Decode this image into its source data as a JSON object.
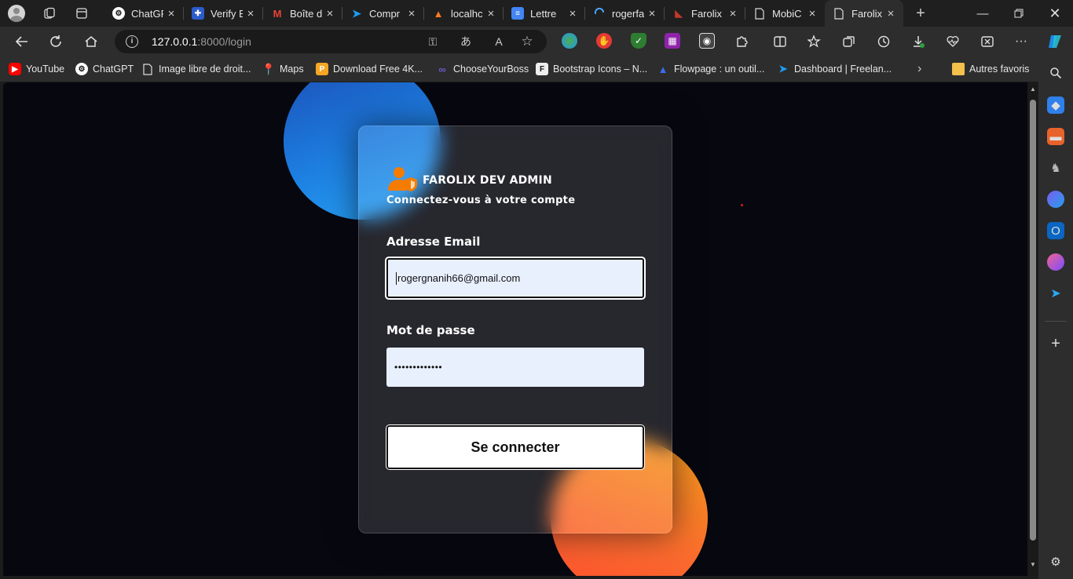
{
  "tabs": [
    {
      "title": "ChatGPT",
      "icon": "chatgpt-icon",
      "color": "#ffffff"
    },
    {
      "title": "Verify E",
      "icon": "puzzle-icon",
      "color": "#3b82f6"
    },
    {
      "title": "Boîte d",
      "icon": "gmail-icon",
      "color": "#ea4335"
    },
    {
      "title": "Compr",
      "icon": "bird-icon",
      "color": "#1d9bf0"
    },
    {
      "title": "localhc",
      "icon": "xampp-icon",
      "color": "#fb7a24"
    },
    {
      "title": "Lettre",
      "icon": "document-icon",
      "color": "#4285f4"
    },
    {
      "title": "rogerfa",
      "icon": "loading-icon",
      "color": "#4aa3ff"
    },
    {
      "title": "Farolix",
      "icon": "farolix-icon",
      "color": "#c0392b"
    },
    {
      "title": "MobiC",
      "icon": "page-icon",
      "color": "#ffffff"
    },
    {
      "title": "Farolix",
      "icon": "page-icon",
      "color": "#ffffff"
    }
  ],
  "address_bar": {
    "host": "127.0.0.1",
    "path": ":8000/login"
  },
  "bookmarks": [
    {
      "label": "YouTube",
      "icon": "youtube-icon"
    },
    {
      "label": "ChatGPT",
      "icon": "chatgpt-icon"
    },
    {
      "label": "Image libre de droit...",
      "icon": "page-icon"
    },
    {
      "label": "Maps",
      "icon": "maps-icon"
    },
    {
      "label": "Download Free 4K...",
      "icon": "download-icon"
    },
    {
      "label": "ChooseYourBoss",
      "icon": "chooseyourboss-icon"
    },
    {
      "label": "Bootstrap Icons – N...",
      "icon": "bootstrap-icon"
    },
    {
      "label": "Flowpage : un outil...",
      "icon": "flowpage-icon"
    },
    {
      "label": "Dashboard | Freelan...",
      "icon": "bird-icon"
    },
    {
      "label": "Autres favoris",
      "icon": "folder-icon"
    }
  ],
  "login": {
    "brand": "FAROLIX DEV ADMIN",
    "subtitle": "Connectez-vous à votre compte",
    "email_label": "Adresse Email",
    "email_value": "rogergnanih66@gmail.com",
    "password_label": "Mot de passe",
    "password_value": "•••••••••••••",
    "submit_label": "Se connecter"
  },
  "colors": {
    "page_bg": "#07070f",
    "accent_orange": "#f57c00",
    "circle_blue": "#1d7fe0",
    "circle_orange": "#fa6a2e"
  }
}
